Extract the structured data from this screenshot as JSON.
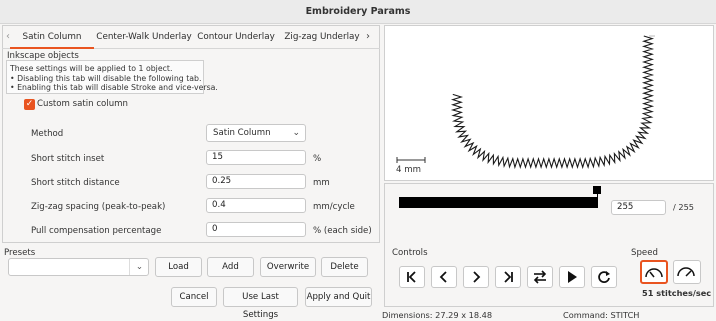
{
  "window": {
    "title": "Embroidery Params"
  },
  "tabs": [
    {
      "label": "Satin Column",
      "active": true
    },
    {
      "label": "Center-Walk Underlay",
      "active": false
    },
    {
      "label": "Contour Underlay",
      "active": false
    },
    {
      "label": "Zig-zag Underlay",
      "active": false
    }
  ],
  "objects": {
    "group_label": "Inkscape objects",
    "info_lines": [
      "These settings will be applied to 1 object.",
      "• Disabling this tab will disable the following tab.",
      "• Enabling this tab will disable Stroke and vice-versa."
    ]
  },
  "custom_satin": {
    "label": "Custom satin column",
    "checked": true
  },
  "params": {
    "method": {
      "label": "Method",
      "value": "Satin Column"
    },
    "short_inset": {
      "label": "Short stitch inset",
      "value": "15",
      "unit": "%"
    },
    "short_distance": {
      "label": "Short stitch distance",
      "value": "0.25",
      "unit": "mm"
    },
    "zigzag": {
      "label": "Zig-zag spacing (peak-to-peak)",
      "value": "0.4",
      "unit": "mm/cycle"
    },
    "pull_comp": {
      "label": "Pull compensation percentage",
      "value": "0",
      "unit": "% (each side)"
    }
  },
  "presets": {
    "label": "Presets",
    "value": "",
    "load": "Load",
    "add": "Add",
    "overwrite": "Overwrite",
    "delete": "Delete"
  },
  "actions": {
    "cancel": "Cancel",
    "use_last": "Use Last Settings",
    "apply_quit": "Apply and Quit"
  },
  "preview": {
    "scale_label": "4 mm"
  },
  "simulator": {
    "current_stitch": "255",
    "total_stitches": "/ 255",
    "progress_fraction": 1.0,
    "controls_label": "Controls",
    "speed_label": "Speed",
    "speed_value": "51 stitches/sec",
    "icons": [
      "skip-to-start-icon",
      "step-back-icon",
      "step-forward-icon",
      "skip-to-end-icon",
      "direction-swap-icon",
      "play-icon",
      "restart-icon"
    ]
  },
  "status": {
    "dimensions": "Dimensions: 27.29 x 18.48",
    "command": "Command: STITCH"
  },
  "colors": {
    "accent": "#e95420",
    "stitch": "#1a1a1a"
  }
}
